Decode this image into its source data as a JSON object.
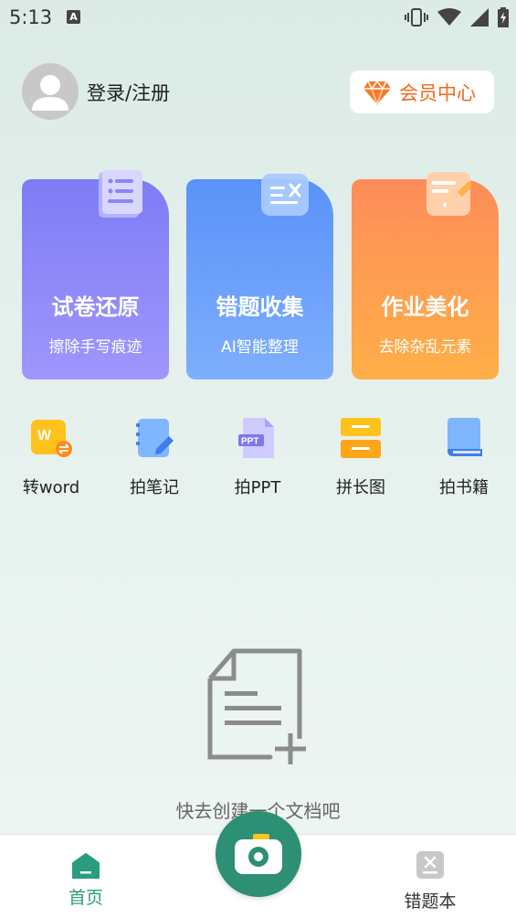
{
  "status_bar": {
    "time": "5:13",
    "notification_letter": "A"
  },
  "header": {
    "login_label": "登录/注册",
    "vip_label": "会员中心"
  },
  "cards": [
    {
      "title": "试卷还原",
      "subtitle": "擦除手写痕迹",
      "icon": "document-scroll-icon"
    },
    {
      "title": "错题收集",
      "subtitle": "AI智能整理",
      "icon": "wrong-list-icon"
    },
    {
      "title": "作业美化",
      "subtitle": "去除杂乱元素",
      "icon": "note-pencil-icon"
    }
  ],
  "tools": [
    {
      "label": "转word",
      "icon": "word-convert-icon"
    },
    {
      "label": "拍笔记",
      "icon": "notebook-pen-icon"
    },
    {
      "label": "拍PPT",
      "icon": "ppt-file-icon",
      "badge": "PPT"
    },
    {
      "label": "拼长图",
      "icon": "long-image-icon"
    },
    {
      "label": "拍书籍",
      "icon": "book-icon"
    }
  ],
  "empty_state": {
    "text": "快去创建一个文档吧"
  },
  "tabbar": {
    "home_label": "首页",
    "wrong_book_label": "错题本"
  },
  "colors": {
    "accent_green": "#2d8f73",
    "vip_orange": "#f36a1f",
    "card_purple": "#8a86f8",
    "card_blue": "#6aa0fa",
    "card_orange": "#ff9c50"
  }
}
